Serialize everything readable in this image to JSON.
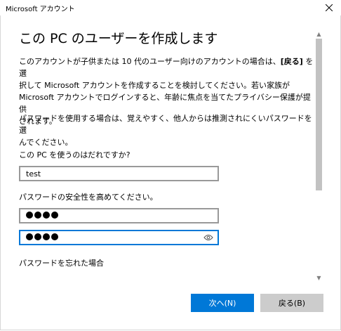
{
  "window": {
    "title": "Microsoft アカウント",
    "close_icon": "close-icon"
  },
  "main": {
    "heading": "この PC のユーザーを作成します",
    "para1_line1_prefix": "このアカウントが子供または 10 代のユーザー向けのアカウントの場合は、",
    "para1_line1_bold": "[戻る]",
    "para1_line1_suffix": " を選",
    "para1_line2": "択して Microsoft アカウントを作成することを検討してください。若い家族が",
    "para1_line3": "Microsoft アカウントでログインすると、年齢に焦点を当てたプライバシー保護が提供",
    "para1_line4": "されます。",
    "para2_line1": "パスワードを使用する場合は、覚えやすく、他人からは推測されにくいパスワードを選",
    "para2_line2": "んでください。",
    "name_label": "この PC を使うのはだれですか?",
    "name_value": "test",
    "password_label": "パスワードの安全性を高めてください。",
    "password_masked_count": 4,
    "confirm_masked_count": 4,
    "forgot_label": "パスワードを忘れた場合"
  },
  "buttons": {
    "next": "次へ(N)",
    "back": "戻る(B)"
  },
  "colors": {
    "accent": "#0078d7",
    "secondary_button": "#cccccc",
    "field_border": "#999999"
  }
}
